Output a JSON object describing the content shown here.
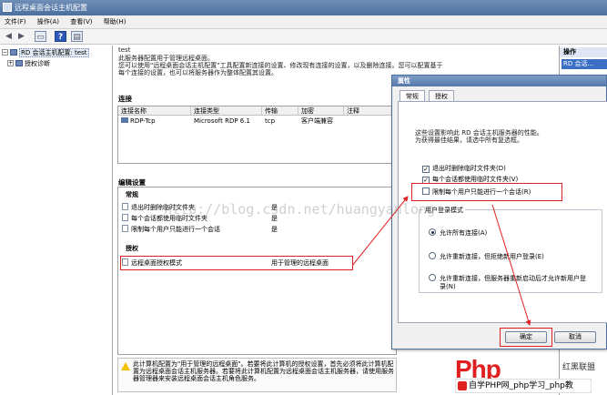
{
  "window": {
    "title": "远程桌面会话主机配置"
  },
  "menu": [
    "文件(F)",
    "操作(A)",
    "查看(V)",
    "帮助(H)"
  ],
  "toolbar": [
    "back-icon",
    "forward-icon",
    "up-icon",
    "help-icon",
    "panel-icon"
  ],
  "tree": {
    "root": "RD 会话主机配置: test",
    "child": "授权诊断"
  },
  "main": {
    "server": "test",
    "intro": [
      "此服务器配置用于管理远程桌面。",
      "您可以使用\"远程桌面会话主机配置\"工具配置新连接的设置、修改现有连接的设置，以及删除连接。您可以配置基于",
      "每个连接的设置，也可以将服务器作为整体配置其设置。"
    ],
    "connections_title": "连接",
    "columns": [
      "连接名称",
      "连接类型",
      "传输",
      "加密",
      "注释"
    ],
    "rows": [
      {
        "name": "RDP-Tcp",
        "type": "Microsoft RDP 6.1",
        "transport": "tcp",
        "encryption": "客户端兼容",
        "comment": ""
      }
    ],
    "edit_title": "编辑设置",
    "general_label": "常规",
    "settings": [
      {
        "label": "退出时删除临时文件夹",
        "value": "是"
      },
      {
        "label": "每个会话都使用临时文件夹",
        "value": "是"
      },
      {
        "label": "限制每个用户只能进行一个会话",
        "value": "是"
      }
    ],
    "licensing_label": "授权",
    "licensing": {
      "label": "远程桌面授权模式",
      "value": "用于管理的远程桌面"
    },
    "warning": "此计算机配置为\"用于管理的远程桌面\"。若要将此计算机的授权设置，首先必须将此计算机配置为远程桌面会话主机服务器。若要将此计算机配置为远程桌面会话主机服务器，请使用服务器管理器来安装远程桌面会话主机角色服务。"
  },
  "actions": {
    "header": "操作",
    "item": "RD 会话..."
  },
  "dialog": {
    "title": "属性",
    "tabs": [
      "常规",
      "授权"
    ],
    "description": [
      "这些设置影响此 RD 会话主机服务器的性能。",
      "为获得最佳结果，请选中所有复选框。"
    ],
    "checkboxes": [
      {
        "label": "退出时删除临时文件夹(D)",
        "checked": true
      },
      {
        "label": "每个会话都使用临时文件夹(V)",
        "checked": true
      },
      {
        "label": "限制每个用户只能进行一个会话(R)",
        "checked": false
      }
    ],
    "logon_group": "用户登录模式",
    "radios": [
      {
        "label": "允许所有连接(A)",
        "selected": true
      },
      {
        "label": "允许重新连接，但拒绝新用户登录(E)",
        "selected": false
      },
      {
        "label": "允许重新连接，但服务器重新启动后才允许新用户登",
        "label2": "录(N)",
        "selected": false
      }
    ],
    "ok": "确定",
    "cancel": "取消"
  },
  "watermark": "http://blog.csdn.net/huangyanlong",
  "brand": {
    "logo": "Php",
    "side": "红黑联盟",
    "bar": "自学PHP网_php学习_php教"
  },
  "colors": {
    "highlight": "#e02020",
    "selection": "#3a6fc4"
  }
}
